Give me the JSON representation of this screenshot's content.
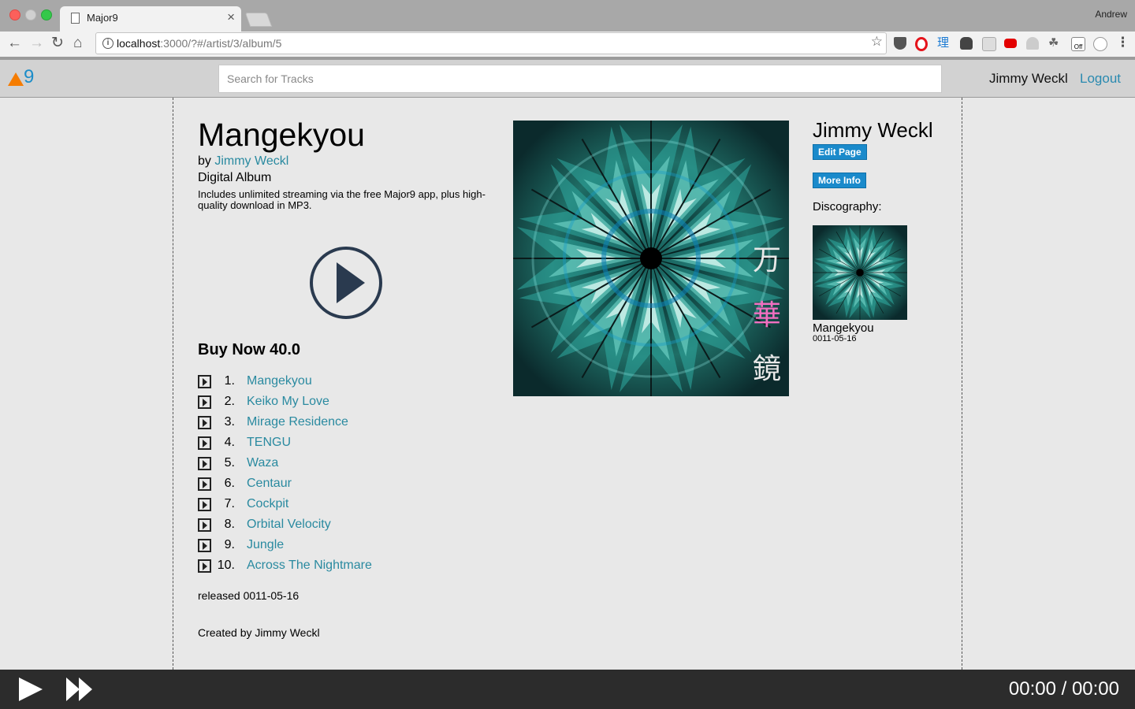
{
  "browser": {
    "tab_title": "Major9",
    "tab_close": "×",
    "profile_name": "Andrew",
    "url_host": "localhost",
    "url_path": ":3000/?#/artist/3/album/5",
    "info_glyph": "i",
    "ext_ri": "理",
    "ext_off": "Off"
  },
  "header": {
    "logo_text": "9",
    "search_placeholder": "Search for Tracks",
    "user_name": "Jimmy Weckl",
    "logout_label": "Logout"
  },
  "album": {
    "title": "Mangekyou",
    "by_prefix": "by ",
    "artist": "Jimmy Weckl",
    "format": "Digital Album",
    "description": "Includes unlimited streaming via the free Major9 app, plus high-quality download in MP3.",
    "buy_label": "Buy Now 40.0",
    "released": "released 0011-05-16",
    "created": "Created by Jimmy Weckl",
    "cover_glyphs": [
      "万",
      "華",
      "鏡"
    ]
  },
  "tracks": [
    {
      "num": "1.",
      "title": "Mangekyou"
    },
    {
      "num": "2.",
      "title": "Keiko My Love"
    },
    {
      "num": "3.",
      "title": "Mirage Residence"
    },
    {
      "num": "4.",
      "title": "TENGU"
    },
    {
      "num": "5.",
      "title": "Waza"
    },
    {
      "num": "6.",
      "title": "Centaur"
    },
    {
      "num": "7.",
      "title": "Cockpit"
    },
    {
      "num": "8.",
      "title": "Orbital Velocity"
    },
    {
      "num": "9.",
      "title": "Jungle"
    },
    {
      "num": "10.",
      "title": "Across The Nightmare"
    }
  ],
  "sidebar": {
    "artist_name": "Jimmy Weckl",
    "edit_label": "Edit Page",
    "more_label": "More Info",
    "discography_label": "Discography:",
    "discography": [
      {
        "title": "Mangekyou",
        "date": "0011-05-16"
      }
    ]
  },
  "player": {
    "time": "00:00 / 00:00"
  },
  "colors": {
    "link": "#2a8aa0",
    "button": "#1a8acb",
    "logo_orange": "#f57c00",
    "logo_blue": "#1c8dc9",
    "player_bg": "#2c2c2c"
  }
}
